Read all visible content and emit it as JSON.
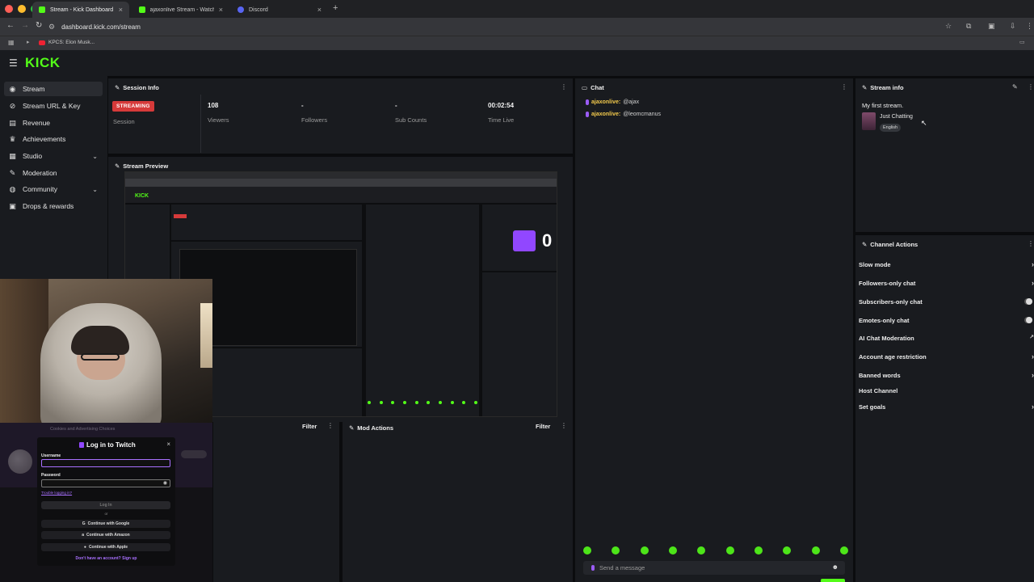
{
  "browser": {
    "tabs": [
      {
        "title": "Stream - Kick Dashboard",
        "favicon_color": "#53fc18"
      },
      {
        "title": "ajaxonlive Stream - Watch Li...",
        "favicon_color": "#53fc18"
      },
      {
        "title": "Discord",
        "favicon_color": "#5865f2"
      }
    ],
    "url": "dashboard.kick.com/stream",
    "bookmark": "KPCS: Elon Musk..."
  },
  "header": {
    "logo": "KICK"
  },
  "sidebar": {
    "items": [
      {
        "label": "Stream",
        "icon": "broadcast-icon"
      },
      {
        "label": "Stream URL & Key",
        "icon": "link-icon"
      },
      {
        "label": "Revenue",
        "icon": "revenue-icon"
      },
      {
        "label": "Achievements",
        "icon": "trophy-icon"
      },
      {
        "label": "Studio",
        "icon": "studio-icon"
      },
      {
        "label": "Moderation",
        "icon": "wrench-icon"
      },
      {
        "label": "Community",
        "icon": "globe-icon"
      },
      {
        "label": "Drops & rewards",
        "icon": "gift-icon"
      }
    ]
  },
  "session": {
    "title": "Session Info",
    "badge": "STREAMING",
    "session_label": "Session",
    "stats": [
      {
        "value": "108",
        "label": "Viewers"
      },
      {
        "value": "-",
        "label": "Followers"
      },
      {
        "value": "-",
        "label": "Sub Counts"
      },
      {
        "value": "00:02:54",
        "label": "Time Live"
      }
    ]
  },
  "preview": {
    "title": "Stream Preview"
  },
  "chat": {
    "title": "Chat",
    "messages": [
      {
        "user": "ajaxonlive:",
        "text": "@ajax"
      },
      {
        "user": "ajaxonlive:",
        "text": "@leomcmanus"
      }
    ],
    "placeholder": "Send a message"
  },
  "stream_info": {
    "title": "Stream info",
    "stream_title": "My first stream.",
    "category": "Just Chatting",
    "language": "English"
  },
  "channel_actions": {
    "title": "Channel Actions",
    "items": [
      {
        "label": "Slow mode",
        "control": "chevron"
      },
      {
        "label": "Followers-only chat",
        "control": "chevron"
      },
      {
        "label": "Subscribers-only chat",
        "control": "toggle"
      },
      {
        "label": "Emotes-only chat",
        "control": "toggle"
      },
      {
        "label": "AI Chat Moderation",
        "control": "external"
      },
      {
        "label": "Account age restriction",
        "control": "chevron"
      },
      {
        "label": "Banned words",
        "control": "chevron"
      },
      {
        "label": "Host Channel",
        "control": "none"
      },
      {
        "label": "Set goals",
        "control": "chevron"
      }
    ]
  },
  "bottom": {
    "filter_label": "Filter",
    "mod_actions_title": "Mod Actions"
  },
  "twitch_login": {
    "title": "Log in to Twitch",
    "username_label": "Username",
    "password_label": "Password",
    "trouble_link": "Trouble logging in?",
    "login_button": "Log In",
    "or": "or",
    "google": "Continue with Google",
    "amazon": "Continue with Amazon",
    "apple": "Continue with Apple",
    "signup": "Don't have an account? Sign up"
  },
  "overlay_text": {
    "faint_banner": "Cookies and Advertising Choices"
  },
  "colors": {
    "kick_green": "#53fc18",
    "streaming_red": "#d63a3a",
    "twitch_purple": "#9147ff"
  }
}
